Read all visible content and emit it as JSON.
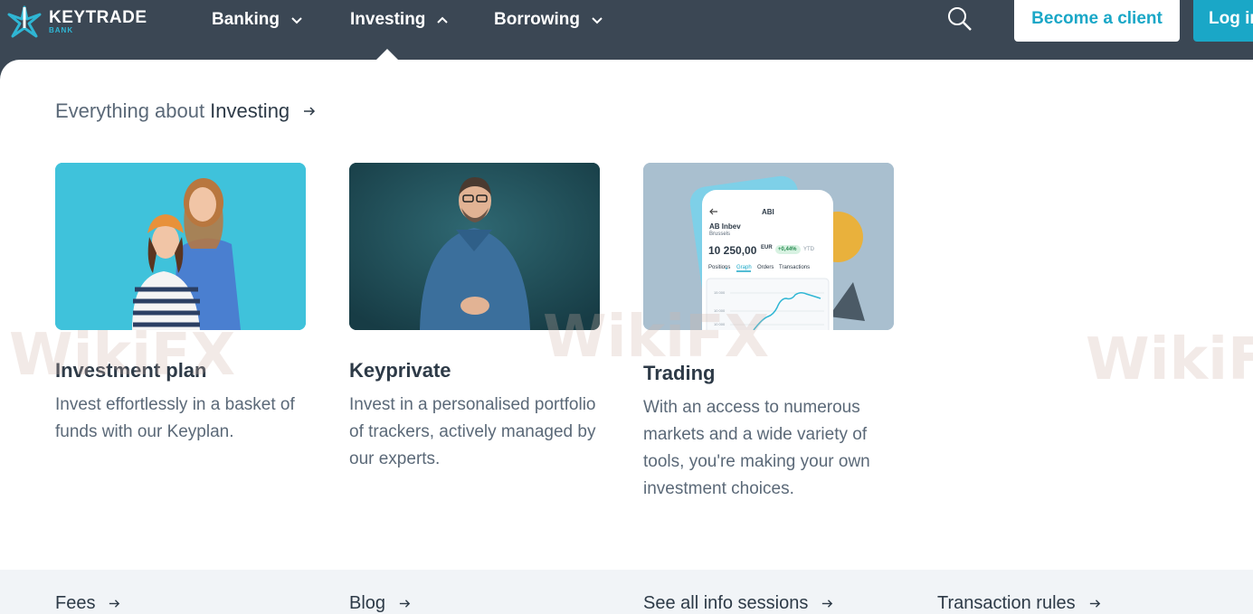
{
  "colors": {
    "topbar": "#3b4754",
    "accent": "#1aa7c7",
    "text_dark": "#2d3a47",
    "text_muted": "#5b6978",
    "footer_bg": "#f1f4f7"
  },
  "logo": {
    "name": "KEYTRADE",
    "sub": "BANK"
  },
  "nav": {
    "items": [
      {
        "label": "Banking",
        "state": "collapsed",
        "icon": "chevron-down-icon"
      },
      {
        "label": "Investing",
        "state": "expanded",
        "icon": "chevron-up-icon"
      },
      {
        "label": "Borrowing",
        "state": "collapsed",
        "icon": "chevron-down-icon"
      }
    ],
    "search_icon": "search-icon",
    "become_client": "Become a client",
    "login": "Log in"
  },
  "menu": {
    "everything_prefix": "Everything about",
    "everything_strong": "Investing",
    "cards": [
      {
        "title": "Investment plan",
        "desc": "Invest effortlessly in a basket of funds with our Keyplan."
      },
      {
        "title": "Keyprivate",
        "desc": "Invest in a personalised portfolio of trackers, actively managed by our experts."
      },
      {
        "title": "Trading",
        "desc": "With an access to numerous markets and a wide variety of tools, you're making your own investment choices."
      }
    ],
    "phone": {
      "symbol": "ABI",
      "company": "AB Inbev",
      "exchange": "Brussels",
      "price": "10 250,00",
      "currency": "EUR",
      "change": "+0,44%",
      "period": "YTD",
      "tabs": [
        "Positions",
        "Graph",
        "Orders",
        "Transactions"
      ],
      "y_ticks": [
        "15 000",
        "10 000",
        "10 000"
      ]
    },
    "footer_links": [
      "Fees",
      "Blog",
      "See all info sessions",
      "Transaction rules"
    ]
  },
  "watermark": "WikiFX"
}
